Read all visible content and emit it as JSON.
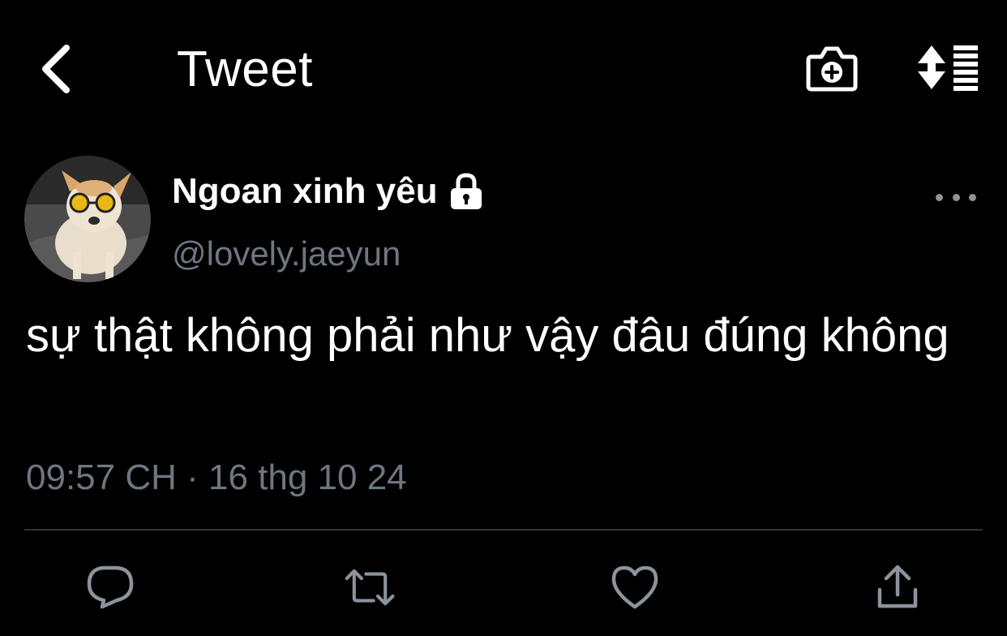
{
  "header": {
    "title": "Tweet",
    "back_icon": "chevron-left-icon",
    "camera_icon": "camera-plus-icon",
    "sort_icon": "sort-list-icon"
  },
  "author": {
    "name": "Ngoan xinh yêu",
    "handle": "@lovely.jaeyun",
    "protected_icon": "lock-icon",
    "avatar": "dog-with-sunglasses-avatar"
  },
  "tweet": {
    "text": "sự thật không phải như vậy đâu đúng không",
    "timestamp": "09:57 CH · 16 thg 10 24"
  },
  "actions": {
    "reply_icon": "reply-icon",
    "retweet_icon": "retweet-icon",
    "like_icon": "heart-icon",
    "share_icon": "share-icon"
  },
  "colors": {
    "background": "#000000",
    "text": "#ffffff",
    "muted": "#6e7681",
    "divider": "#2f3336",
    "icon": "#8b939c"
  }
}
